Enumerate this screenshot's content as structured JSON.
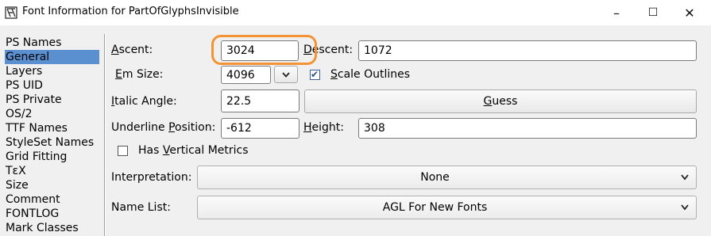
{
  "window": {
    "title": "Font Information for PartOfGlyphsInvisible",
    "minimize_glyph": "–",
    "maximize_glyph": "☐",
    "close_glyph": "✕"
  },
  "sidebar": {
    "items": [
      {
        "label": "PS Names",
        "selected": false
      },
      {
        "label": "General",
        "selected": true
      },
      {
        "label": "Layers",
        "selected": false
      },
      {
        "label": "PS UID",
        "selected": false
      },
      {
        "label": "PS Private",
        "selected": false
      },
      {
        "label": "OS/2",
        "selected": false
      },
      {
        "label": "TTF Names",
        "selected": false
      },
      {
        "label": "StyleSet Names",
        "selected": false
      },
      {
        "label": "Grid Fitting",
        "selected": false
      },
      {
        "label": "TεX",
        "selected": false
      },
      {
        "label": "Size",
        "selected": false
      },
      {
        "label": "Comment",
        "selected": false
      },
      {
        "label": "FONTLOG",
        "selected": false
      },
      {
        "label": "Mark Classes",
        "selected": false
      }
    ]
  },
  "general": {
    "ascent": {
      "label_first": "A",
      "label_rest": "scent:",
      "value": "3024"
    },
    "descent": {
      "label_first": "D",
      "label_rest": "escent:",
      "value": "1072"
    },
    "em_size": {
      "label_first": "E",
      "label_rest": "m Size:",
      "value": "4096"
    },
    "scale_outlines": {
      "label_first": "S",
      "label_rest": "cale Outlines",
      "checked": true,
      "check_glyph": "✔"
    },
    "italic_angle": {
      "label_first": "I",
      "label_rest": "talic Angle:",
      "value": "22.5"
    },
    "guess_button": {
      "label_first": "G",
      "label_rest": "uess"
    },
    "underline_position": {
      "label_pre": "Underline ",
      "label_first": "P",
      "label_rest": "osition:",
      "value": "-612"
    },
    "height": {
      "label_first": "H",
      "label_rest": "eight:",
      "value": "308"
    },
    "vertical_metrics": {
      "label_pre": "Has ",
      "label_first": "V",
      "label_rest": "ertical Metrics",
      "checked": false
    },
    "interpretation": {
      "label": "Interpretation:",
      "value": "None"
    },
    "name_list": {
      "label": "Name List:",
      "value": "AGL For New Fonts"
    }
  },
  "colors": {
    "selection": "#5a8fd0",
    "highlight_ring": "#f39334"
  }
}
